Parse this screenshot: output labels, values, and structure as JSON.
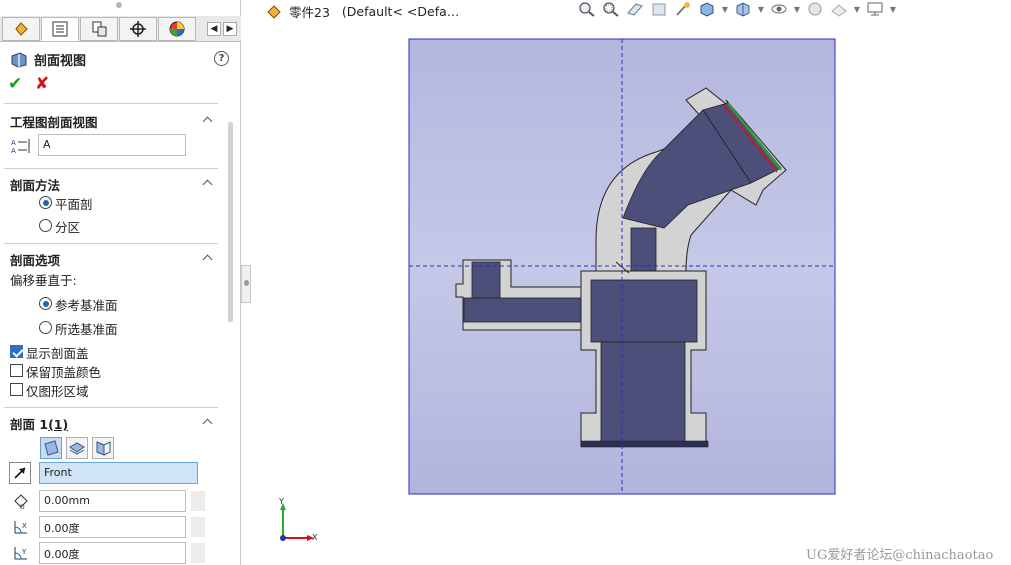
{
  "panel": {
    "tabs": [
      "feature-manager",
      "property-manager",
      "configuration-manager",
      "dimxpert",
      "display-manager"
    ],
    "title": "剖面视图",
    "help_label": "?",
    "sections": {
      "section_view": {
        "title": "工程图剖面视图",
        "label_value": "A"
      },
      "method": {
        "title": "剖面方法",
        "options": [
          "平面剖",
          "分区"
        ],
        "selected": "平面剖"
      },
      "options": {
        "title": "剖面选项",
        "offset_label": "偏移垂直于:",
        "ref_options": [
          "参考基准面",
          "所选基准面"
        ],
        "selected": "参考基准面",
        "checkboxes": [
          {
            "label": "显示剖面盖",
            "checked": true
          },
          {
            "label": "保留顶盖颜色",
            "checked": false
          },
          {
            "label": "仅图形区域",
            "checked": false
          }
        ]
      },
      "section1": {
        "title": "剖面 1",
        "title_suffix": "(1)",
        "plane": "Front",
        "offset": "0.00mm",
        "angle_x": "0.00度",
        "angle_y": "0.00度"
      }
    }
  },
  "graphics": {
    "doc_name": "零件23",
    "doc_config": "(Default< <Defa…",
    "watermark": "UG爱好者论坛@chinachaotao",
    "triad": {
      "x_label": "X",
      "y_label": "Y"
    },
    "toolbar_icons": [
      "zoom-to-fit-icon",
      "zoom-to-area-icon",
      "previous-view-icon",
      "section-view-icon",
      "dynamic-annotation-icon",
      "view-orientation-icon",
      "display-style-icon",
      "hide-show-icon",
      "edit-appearance-icon",
      "apply-scene-icon",
      "view-settings-icon"
    ]
  },
  "colors": {
    "plane": "#b8bbe0",
    "plane_border": "#2b2ec4",
    "cap": "#d3d3d3",
    "body": "#4c4f7a",
    "accent_green": "#1a9a1a",
    "accent_red": "#d0141a"
  }
}
